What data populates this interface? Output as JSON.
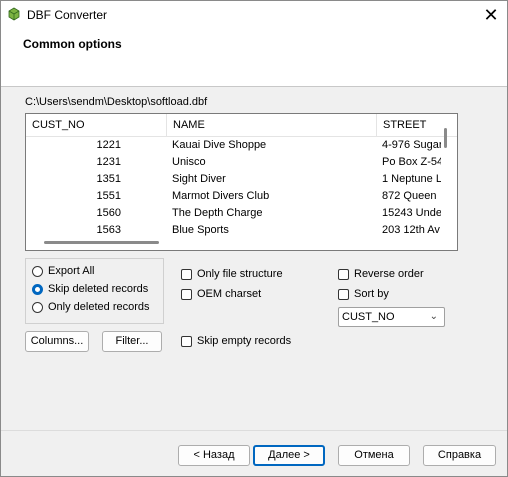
{
  "window": {
    "title": "DBF Converter",
    "close_glyph": "✕"
  },
  "header": {
    "section_title": "Common options"
  },
  "file_path": "C:\\Users\\sendm\\Desktop\\softload.dbf",
  "grid": {
    "columns": [
      "CUST_NO",
      "NAME",
      "STREET"
    ],
    "rows": [
      [
        "1221",
        "Kauai Dive Shoppe",
        "4-976 Sugar"
      ],
      [
        "1231",
        "Unisco",
        "Po Box Z-54"
      ],
      [
        "1351",
        "Sight Diver",
        "1 Neptune L"
      ],
      [
        "1551",
        "Marmot Divers Club",
        "872 Queen"
      ],
      [
        "1560",
        "The Depth Charge",
        "15243 Unde"
      ],
      [
        "1563",
        "Blue Sports",
        "203 12th Av"
      ]
    ]
  },
  "records_mode": {
    "options": [
      "Export All",
      "Skip deleted records",
      "Only deleted records"
    ],
    "selected_index": 1
  },
  "checkboxes": {
    "only_file_structure": {
      "label": "Only file structure",
      "checked": false
    },
    "oem_charset": {
      "label": "OEM charset",
      "checked": false
    },
    "skip_empty_records": {
      "label": "Skip empty records",
      "checked": false
    },
    "reverse_order": {
      "label": "Reverse order",
      "checked": false
    },
    "sort_by": {
      "label": "Sort by",
      "checked": false
    }
  },
  "sort_field": {
    "value": "CUST_NO",
    "arrow_glyph": "⌄"
  },
  "buttons": {
    "columns": "Columns...",
    "filter": "Filter...",
    "back": "< Назад",
    "next": "Далее >",
    "cancel": "Отмена",
    "help": "Справка"
  },
  "icons": {
    "app_icon": "dbf-converter-icon",
    "close": "close-icon",
    "dropdown": "chevron-down-icon"
  },
  "colors": {
    "accent": "#0067c0",
    "window_bg": "#f0f0f0",
    "panel_bg": "#ffffff"
  }
}
